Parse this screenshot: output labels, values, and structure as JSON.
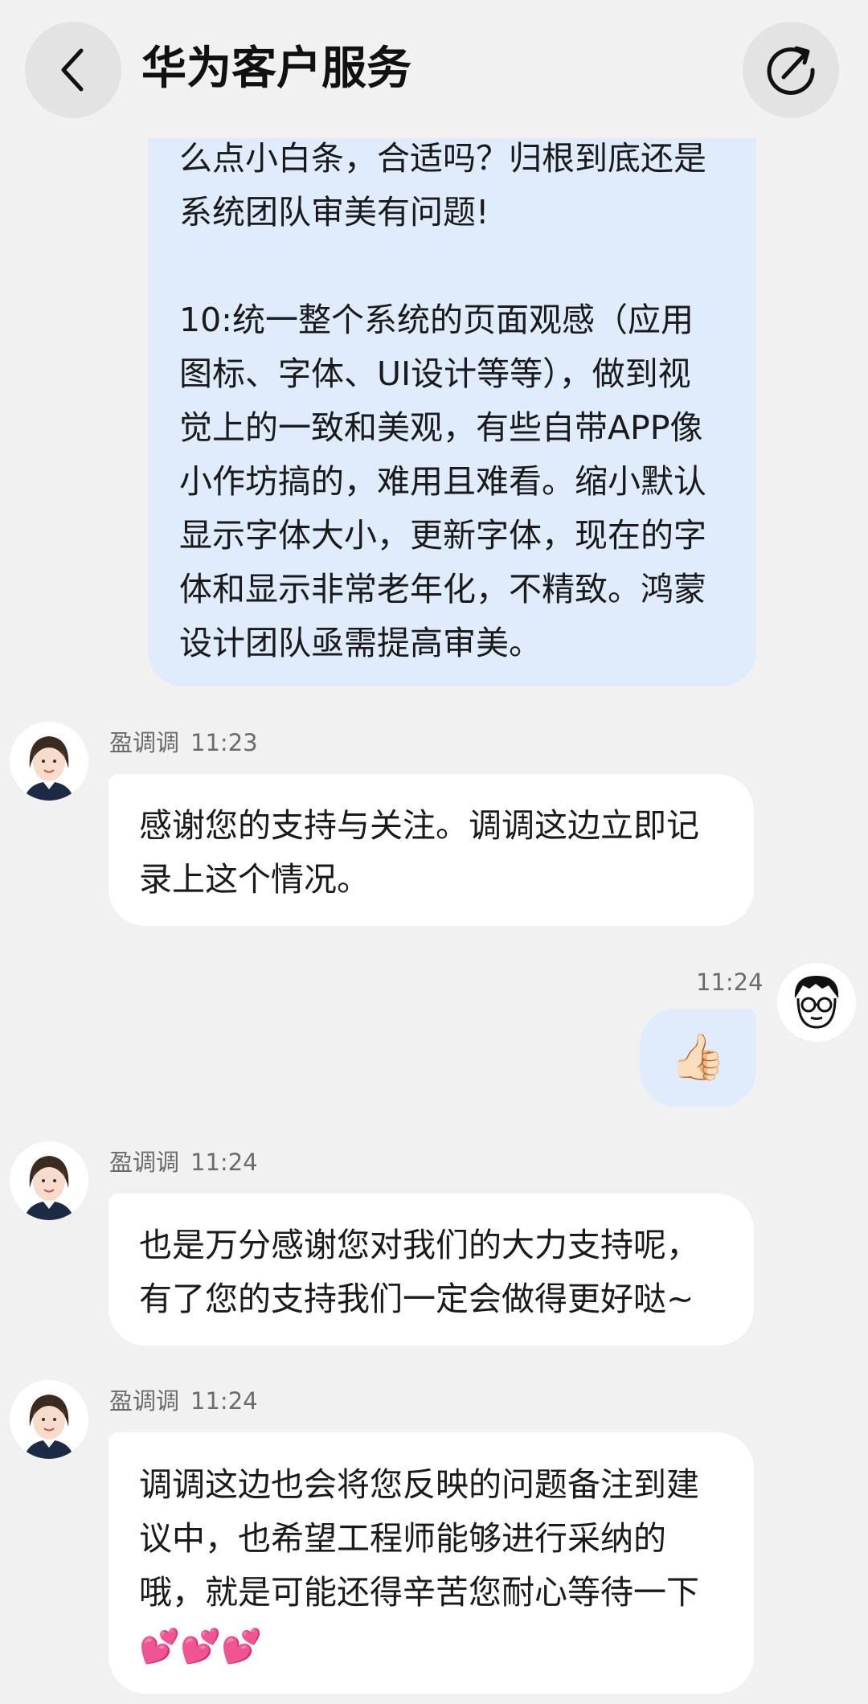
{
  "header": {
    "title": "华为客户服务",
    "back_icon": "chevron-left-icon",
    "refresh_icon": "refresh-icon"
  },
  "messages": [
    {
      "sender": "user",
      "text": "么点小白条，合适吗？归根到底还是\n系统团队审美有问题!\n\n10:统一整个系统的页面观感（应用\n图标、字体、UI设计等等），做到视\n觉上的一致和美观，有些自带APP像\n小作坊搞的，难用且难看。缩小默认\n显示字体大小，更新字体，现在的字\n体和显示非常老年化，不精致。鸿蒙\n设计团队亟需提高审美。"
    },
    {
      "sender": "agent",
      "name": "盈调调",
      "time": "11:23",
      "text": "感谢您的支持与关注。调调这边立即记\n录上这个情况。"
    },
    {
      "sender": "user",
      "time": "11:24",
      "text": "👍🏻"
    },
    {
      "sender": "agent",
      "name": "盈调调",
      "time": "11:24",
      "text": "也是万分感谢您对我们的大力支持呢，\n有了您的支持我们一定会做得更好哒~"
    },
    {
      "sender": "agent",
      "name": "盈调调",
      "time": "11:24",
      "text": "调调这边也会将您反映的问题备注到建\n议中，也希望工程师能够进行采纳的\n哦，就是可能还得辛苦您耐心等待一下\n💕💕💕"
    }
  ]
}
